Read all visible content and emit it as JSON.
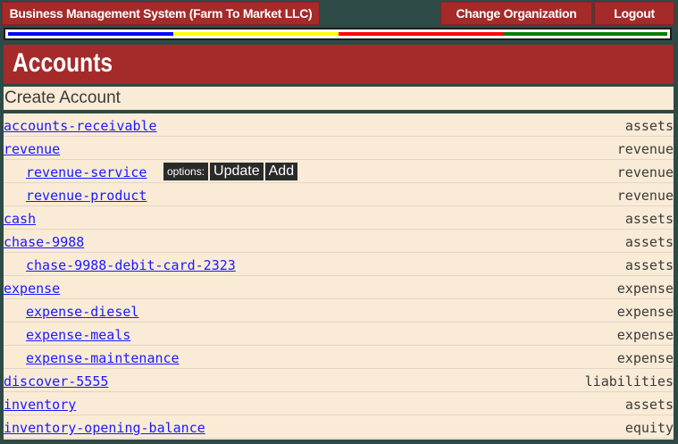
{
  "topbar": {
    "title": "Business Management System (Farm To Market LLC)",
    "change_org": "Change Organization",
    "logout": "Logout"
  },
  "colors": {
    "stripe": [
      "#0000ff",
      "#ffff00",
      "#ff0000",
      "#008000"
    ],
    "header_bg": "#a52a2a",
    "panel_bg": "#faebd7",
    "link": "#1a1aff"
  },
  "page": {
    "title": "Accounts",
    "create_label": "Create Account"
  },
  "options": {
    "label": "options:",
    "update": "Update",
    "add": "Add"
  },
  "accounts": [
    {
      "name": "accounts-receivable",
      "type": "assets",
      "child": false
    },
    {
      "name": "revenue",
      "type": "revenue",
      "child": false
    },
    {
      "name": "revenue-service",
      "type": "revenue",
      "child": true,
      "options": true
    },
    {
      "name": "revenue-product",
      "type": "revenue",
      "child": true
    },
    {
      "name": "cash",
      "type": "assets",
      "child": false
    },
    {
      "name": "chase-9988",
      "type": "assets",
      "child": false
    },
    {
      "name": "chase-9988-debit-card-2323",
      "type": "assets",
      "child": true
    },
    {
      "name": "expense",
      "type": "expense",
      "child": false
    },
    {
      "name": "expense-diesel",
      "type": "expense",
      "child": true
    },
    {
      "name": "expense-meals",
      "type": "expense",
      "child": true
    },
    {
      "name": "expense-maintenance",
      "type": "expense",
      "child": true
    },
    {
      "name": "discover-5555",
      "type": "liabilities",
      "child": false
    },
    {
      "name": "inventory",
      "type": "assets",
      "child": false
    },
    {
      "name": "inventory-opening-balance",
      "type": "equity",
      "child": false
    }
  ]
}
